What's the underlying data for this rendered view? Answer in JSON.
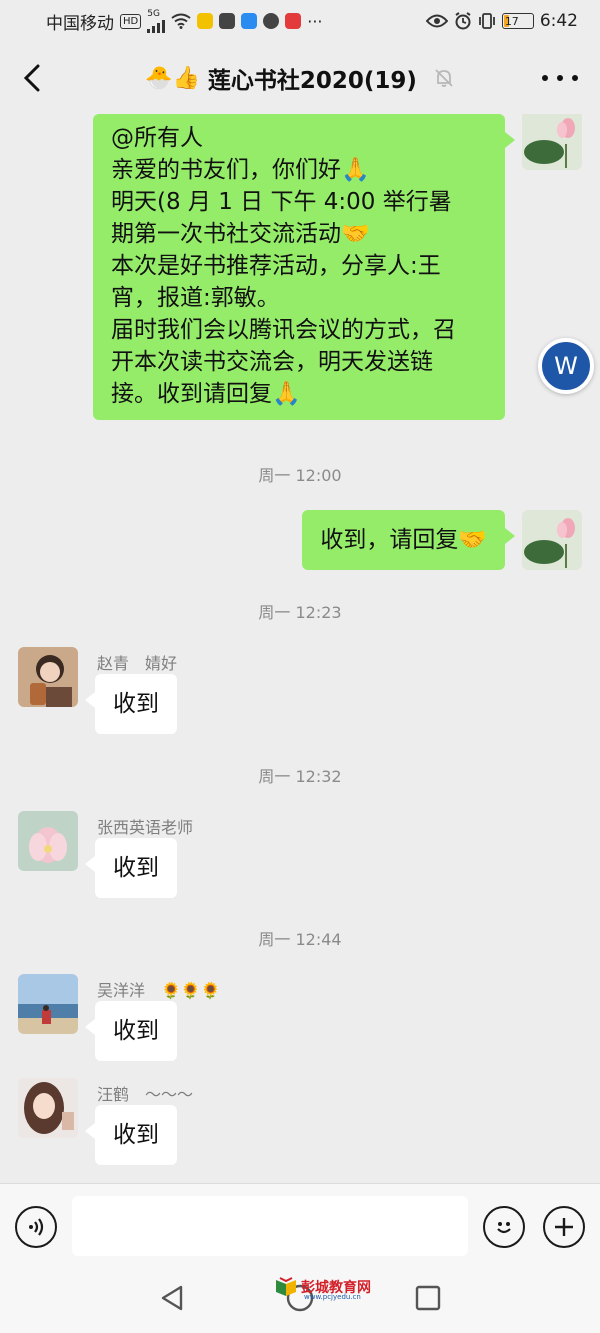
{
  "status_bar": {
    "carrier": "中国移动",
    "hd_badge": "HD",
    "net_type": "5G",
    "battery_level": "17",
    "battery_fraction": 0.17,
    "time": "6:42",
    "app_icon_colors": [
      "#f2c200",
      "#444444",
      "#2a8cf0",
      "#444444",
      "#e33b3b"
    ]
  },
  "header": {
    "emojis": "🐣👍",
    "title": "莲心书社2020(19)"
  },
  "messages": [
    {
      "side": "me",
      "lines": [
        "@所有人",
        "亲爱的书友们，你们好🙏",
        "明天(8 月 1 日 下午 4:00 举行暑",
        "期第一次书社交流活动🤝",
        "本次是好书推荐活动，分享人:王",
        "宵，报道:郭敏。",
        "届时我们会以腾讯会议的方式，召",
        "开本次读书交流会，明天发送链",
        "接。收到请回复🙏"
      ]
    },
    {
      "time": "周一 12:00"
    },
    {
      "side": "me",
      "text": "收到，请回复🤝"
    },
    {
      "time": "周一 12:23"
    },
    {
      "side": "them",
      "sender": "赵青　婧好",
      "text": "收到"
    },
    {
      "time": "周一 12:32"
    },
    {
      "side": "them",
      "sender": "张西英语老师",
      "text": "收到"
    },
    {
      "time": "周一 12:44"
    },
    {
      "side": "them",
      "sender": "吴洋洋　🌻🌻🌻",
      "text": "收到"
    },
    {
      "side": "them",
      "sender": "汪鹤　～～～",
      "text": "收到"
    }
  ],
  "floating_button": {
    "label": "W"
  },
  "watermark": {
    "name": "彭城教育网",
    "url": "www.pcjyedu.cn"
  },
  "colors": {
    "my_bubble": "#95ec69",
    "their_bubble": "#ffffff",
    "background": "#ededed",
    "float_button": "#1f57a8"
  }
}
